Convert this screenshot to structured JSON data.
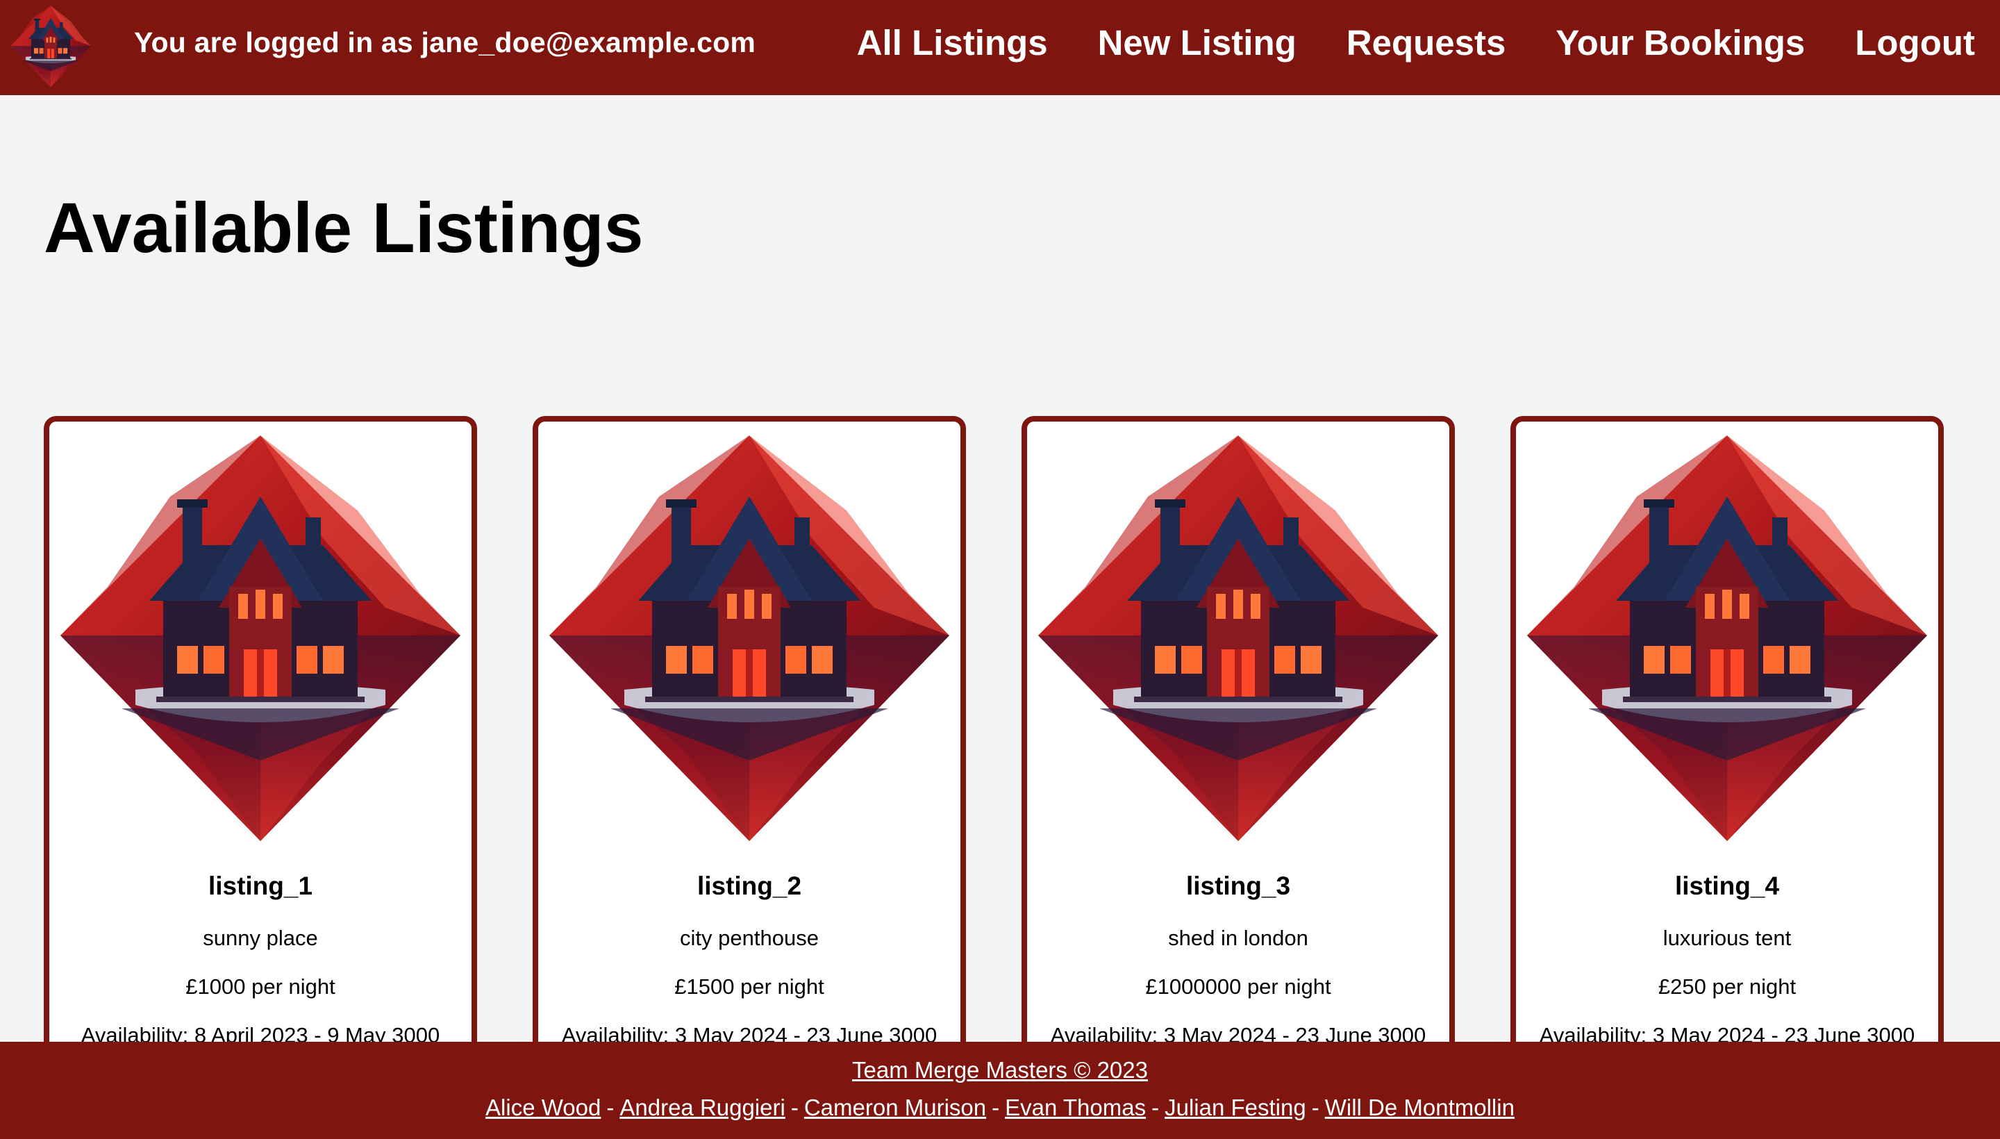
{
  "navbar": {
    "user_text": "You are logged in as jane_doe@example.com",
    "logo_icon": "house-logo-icon",
    "links": [
      "All Listings",
      "New Listing",
      "Requests",
      "Your Bookings",
      "Logout"
    ]
  },
  "main": {
    "title": "Available Listings",
    "listings": [
      {
        "name": "listing_1",
        "description": "sunny place",
        "price": "£1000 per night",
        "availability": "Availability: 8 April 2023 - 9 May 3000",
        "image_icon": "house-diamond-image"
      },
      {
        "name": "listing_2",
        "description": "city penthouse",
        "price": "£1500 per night",
        "availability": "Availability: 3 May 2024 - 23 June 3000",
        "image_icon": "house-diamond-image"
      },
      {
        "name": "listing_3",
        "description": "shed in london",
        "price": "£1000000 per night",
        "availability": "Availability: 3 May 2024 - 23 June 3000",
        "image_icon": "house-diamond-image"
      },
      {
        "name": "listing_4",
        "description": "luxurious tent",
        "price": "£250 per night",
        "availability": "Availability: 3 May 2024 - 23 June 3000",
        "image_icon": "house-diamond-image"
      }
    ]
  },
  "footer": {
    "copyright": "Team Merge Masters © 2023",
    "names": [
      "Alice Wood",
      "Andrea Ruggieri",
      "Cameron Murison",
      "Evan Thomas",
      "Julian Festing",
      "Will De Montmollin"
    ],
    "separator": "-"
  },
  "colors": {
    "brand": "#7e150f",
    "background": "#f4f4f4",
    "accent_red": "#d7281f",
    "roof_navy": "#1d2a4d",
    "window_glow": "#ff5a2a"
  }
}
